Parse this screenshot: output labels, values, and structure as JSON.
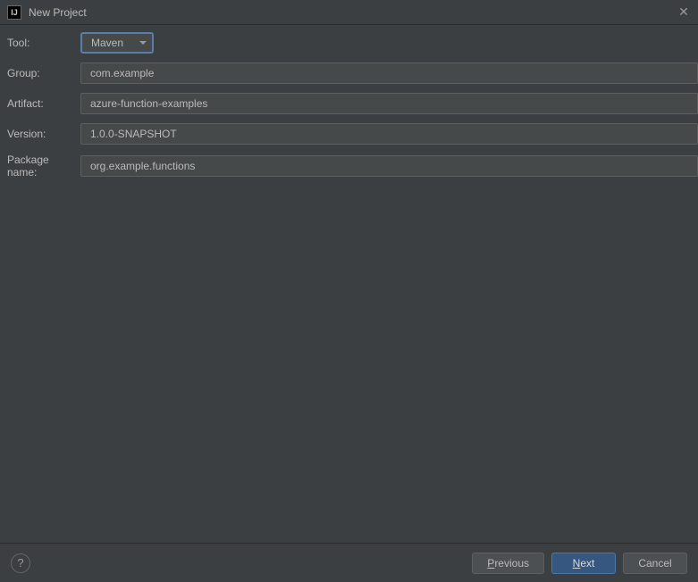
{
  "titlebar": {
    "title": "New Project"
  },
  "form": {
    "toolLabel": "Tool:",
    "toolValue": "Maven",
    "groupLabel": "Group:",
    "groupValue": "com.example",
    "artifactLabel": "Artifact:",
    "artifactValue": "azure-function-examples",
    "versionLabel": "Version:",
    "versionValue": "1.0.0-SNAPSHOT",
    "packageLabel": "Package name:",
    "packageValue": "org.example.functions"
  },
  "footer": {
    "help": "?",
    "previousPrefix": "P",
    "previousRest": "revious",
    "nextPrefix": "N",
    "nextRest": "ext",
    "cancel": "Cancel"
  }
}
